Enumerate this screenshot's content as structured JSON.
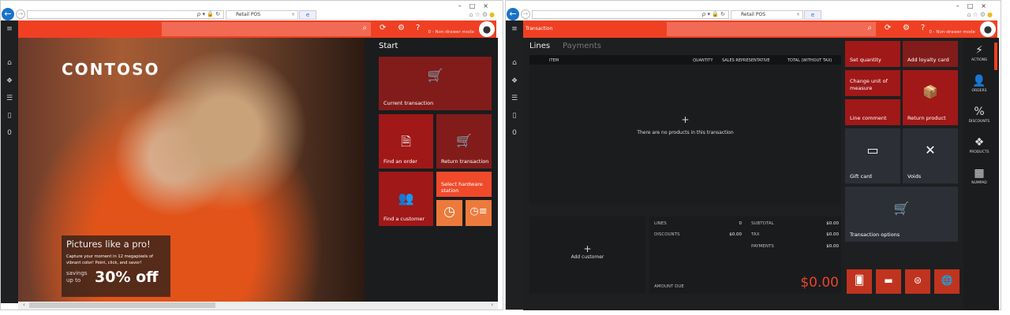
{
  "browser": {
    "tab_title": "Retail POS",
    "address": "ρ ▾ 🔒 ↻"
  },
  "header": {
    "mode": "0 - Non-drawer mode",
    "search_icon": "search-icon"
  },
  "sidebar": {
    "count": "0"
  },
  "left": {
    "logo": "CONTOSO",
    "promo": {
      "title": "Pictures like a pro!",
      "body": "Capture your moment in 12 megapixels of vibrant color!  Point, click, and savor!",
      "savings": "savings up to",
      "discount": "30% off"
    },
    "start": {
      "title": "Start",
      "tiles": [
        {
          "label": "Current transaction",
          "icon": "cart-icon"
        },
        {
          "label": "Find an order",
          "icon": "find-order-icon"
        },
        {
          "label": "Return transaction",
          "icon": "return-cart-icon"
        },
        {
          "label": "Find a customer",
          "icon": "find-customer-icon"
        },
        {
          "label": "Select hardware station",
          "icon": ""
        },
        {
          "label": "",
          "icon": "clock-icon"
        },
        {
          "label": "",
          "icon": "time-list-icon"
        }
      ]
    }
  },
  "right": {
    "header_title": "Transaction",
    "tabs": [
      "Lines",
      "Payments"
    ],
    "columns": [
      "ITEM",
      "QUANTITY",
      "SALES REPRESENTATIVE",
      "TOTAL (WITHOUT TAX)"
    ],
    "empty": "There are no products in this transaction",
    "add_customer": "Add customer",
    "totals": {
      "lines_label": "LINES",
      "lines": "0",
      "discounts_label": "DISCOUNTS",
      "discounts": "$0.00",
      "subtotal_label": "SUBTOTAL",
      "subtotal": "$0.00",
      "tax_label": "TAX",
      "tax": "$0.00",
      "payments_label": "PAYMENTS",
      "payments": "$0.00",
      "amount_due_label": "AMOUNT DUE",
      "amount_due": "$0.00"
    },
    "tiles": [
      "Set quantity",
      "Add loyalty card",
      "Change unit of measure",
      "Line comment",
      "Return product",
      "Gift card",
      "Voids",
      "Transaction options"
    ],
    "nav": [
      "ACTIONS",
      "ORDERS",
      "DISCOUNTS",
      "PRODUCTS",
      "NUMPAD"
    ]
  },
  "colors": {
    "accent": "#f04023",
    "tile_red": "#a01818",
    "amount_due": "#e8452a"
  }
}
